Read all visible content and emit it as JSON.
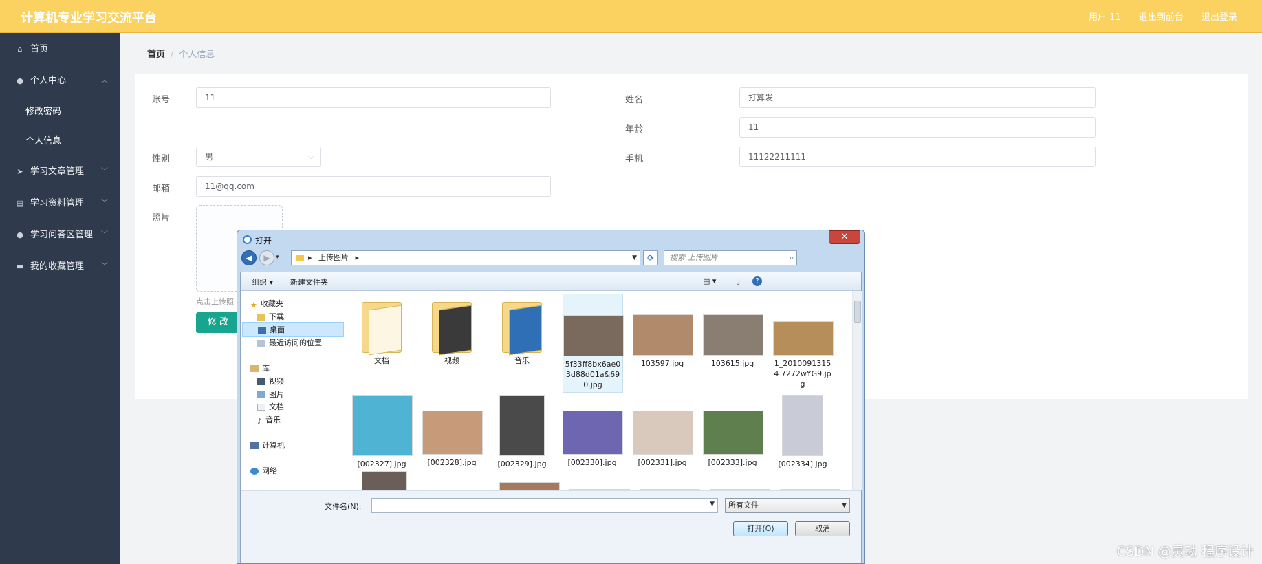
{
  "header": {
    "title": "计算机专业学习交流平台",
    "user": "用户 11",
    "back_link": "退出到前台",
    "logout": "退出登录"
  },
  "sidebar": {
    "items": [
      {
        "label": "首页",
        "icon": "home-icon"
      },
      {
        "label": "个人中心",
        "icon": "user-icon",
        "expanded": true,
        "children": [
          "修改密码",
          "个人信息"
        ]
      },
      {
        "label": "学习文章管理",
        "icon": "send-icon"
      },
      {
        "label": "学习资料管理",
        "icon": "clipboard-icon"
      },
      {
        "label": "学习问答区管理",
        "icon": "user-icon"
      },
      {
        "label": "我的收藏管理",
        "icon": "briefcase-icon"
      }
    ]
  },
  "breadcrumb": {
    "home": "首页",
    "sep": "/",
    "current": "个人信息"
  },
  "form": {
    "account_label": "账号",
    "account_value": "11",
    "name_label": "姓名",
    "name_value": "打算发",
    "age_label": "年龄",
    "age_value": "11",
    "gender_label": "性别",
    "gender_value": "男",
    "phone_label": "手机",
    "phone_value": "11122211111",
    "email_label": "邮箱",
    "email_value": "11@qq.com",
    "photo_label": "照片",
    "upload_hint": "点击上传照",
    "submit_label": "修 改"
  },
  "dialog": {
    "title": "打开",
    "path": "上传图片",
    "search_placeholder": "搜索 上传图片",
    "organize": "组织 ▾",
    "new_folder": "新建文件夹",
    "nav": {
      "favorites": "收藏夹",
      "downloads": "下载",
      "desktop": "桌面",
      "recent": "最近访问的位置",
      "libraries": "库",
      "videos": "视频",
      "pictures": "图片",
      "documents": "文档",
      "music": "音乐",
      "computer": "计算机",
      "network": "网络"
    },
    "files": [
      {
        "name": "文档",
        "kind": "folder"
      },
      {
        "name": "视频",
        "kind": "folder"
      },
      {
        "name": "音乐",
        "kind": "folder"
      },
      {
        "name": "5f33ff8bx6ae03d88d01a&690.jpg",
        "kind": "image",
        "color": "#7a6a5e"
      },
      {
        "name": "103597.jpg",
        "kind": "image",
        "color": "#b08a6a"
      },
      {
        "name": "103615.jpg",
        "kind": "image",
        "color": "#8a7d72"
      },
      {
        "name": "1_20100913154 7272wYG9.jpg",
        "kind": "image",
        "color": "#b58e5a"
      },
      {
        "name": "[002327].jpg",
        "kind": "image",
        "color": "#4fb3d4"
      },
      {
        "name": "[002328].jpg",
        "kind": "image",
        "color": "#c79b7a"
      },
      {
        "name": "[002329].jpg",
        "kind": "image",
        "color": "#4a4a4a"
      },
      {
        "name": "[002330].jpg",
        "kind": "image",
        "color": "#6e66b0"
      },
      {
        "name": "[002331].jpg",
        "kind": "image",
        "color": "#d9c9bd"
      },
      {
        "name": "[002333].jpg",
        "kind": "image",
        "color": "#5f7f4f"
      },
      {
        "name": "[002334].jpg",
        "kind": "image",
        "color": "#c9cbd6"
      }
    ],
    "filename_label": "文件名(N):",
    "filetype": "所有文件",
    "open_btn": "打开(O)",
    "cancel_btn": "取消"
  },
  "watermark": "CSDN @灵动 程序设计"
}
